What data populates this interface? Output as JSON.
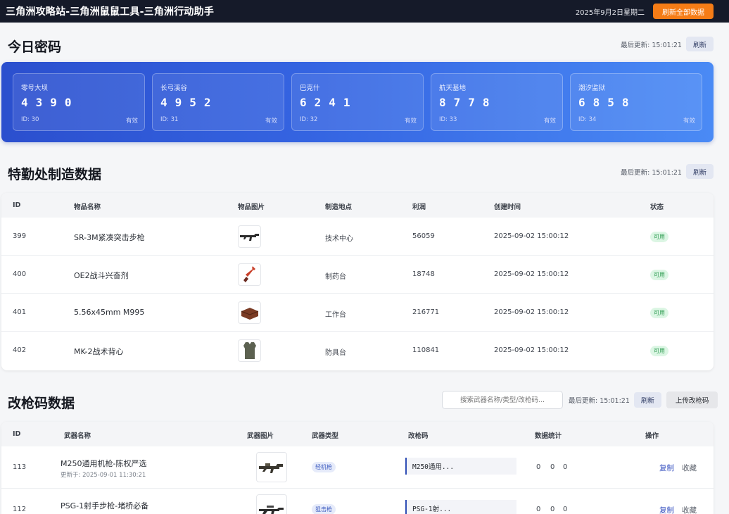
{
  "header": {
    "title": "三角洲攻略站-三角洲鼠鼠工具-三角洲行动助手",
    "date": "2025年9月2日星期二",
    "refresh_all_label": "刷新全部数据"
  },
  "passwords": {
    "title": "今日密码",
    "last_updated": "最后更新: 15:01:21",
    "refresh_label": "刷新",
    "cards": [
      {
        "name": "零号大坝",
        "code": "4390",
        "id": "ID: 30",
        "status": "有效"
      },
      {
        "name": "长弓溪谷",
        "code": "4952",
        "id": "ID: 31",
        "status": "有效"
      },
      {
        "name": "巴克什",
        "code": "6241",
        "id": "ID: 32",
        "status": "有效"
      },
      {
        "name": "航天基地",
        "code": "8778",
        "id": "ID: 33",
        "status": "有效"
      },
      {
        "name": "潮汐监狱",
        "code": "6858",
        "id": "ID: 34",
        "status": "有效"
      }
    ]
  },
  "crafting": {
    "title": "特勤处制造数据",
    "last_updated": "最后更新: 15:01:21",
    "refresh_label": "刷新",
    "columns": [
      "ID",
      "物品名称",
      "物品图片",
      "制造地点",
      "利润",
      "创建时间",
      "状态"
    ],
    "rows": [
      {
        "id": "399",
        "name": "SR-3M紧凑突击步枪",
        "icon": "rifle-icon",
        "place": "技术中心",
        "profit": "56059",
        "time": "2025-09-02 15:00:12",
        "status": "可用"
      },
      {
        "id": "400",
        "name": "OE2战斗兴奋剂",
        "icon": "syringe-icon",
        "place": "制药台",
        "profit": "18748",
        "time": "2025-09-02 15:00:12",
        "status": "可用"
      },
      {
        "id": "401",
        "name": "5.56x45mm M995",
        "icon": "ammo-box-icon",
        "place": "工作台",
        "profit": "216771",
        "time": "2025-09-02 15:00:12",
        "status": "可用"
      },
      {
        "id": "402",
        "name": "MK-2战术背心",
        "icon": "vest-icon",
        "place": "防具台",
        "profit": "110841",
        "time": "2025-09-02 15:00:12",
        "status": "可用"
      }
    ]
  },
  "mods": {
    "title": "改枪码数据",
    "search_placeholder": "搜索武器名称/类型/改枪码...",
    "last_updated": "最后更新: 15:01:21",
    "refresh_label": "刷新",
    "upload_label": "上传改枪码",
    "columns": [
      "ID",
      "武器名称",
      "武器图片",
      "武器类型",
      "改枪码",
      "数据统计",
      "操作"
    ],
    "rows": [
      {
        "id": "113",
        "name": "M250通用机枪-陈权严选",
        "updated": "更新于: 2025-09-01 11:30:21",
        "icon": "machine-gun-icon",
        "type": "轻机枪",
        "code": "M250通用...",
        "stats": [
          "0",
          "0",
          "0"
        ],
        "copy": "复制",
        "fav": "收藏"
      },
      {
        "id": "112",
        "name": "PSG-1射手步枪-堵桥必备",
        "updated": "",
        "icon": "sniper-rifle-icon",
        "type": "狙击枪",
        "code": "PSG-1射...",
        "stats": [
          "0",
          "0",
          "0"
        ],
        "copy": "复制",
        "fav": "收藏"
      }
    ]
  },
  "colors": {
    "topbar": "#151a29",
    "accent_orange": "#f57c16",
    "panel_blue": "#3565e2",
    "status_green": "#2d9a4f",
    "link_blue": "#3852c0"
  }
}
